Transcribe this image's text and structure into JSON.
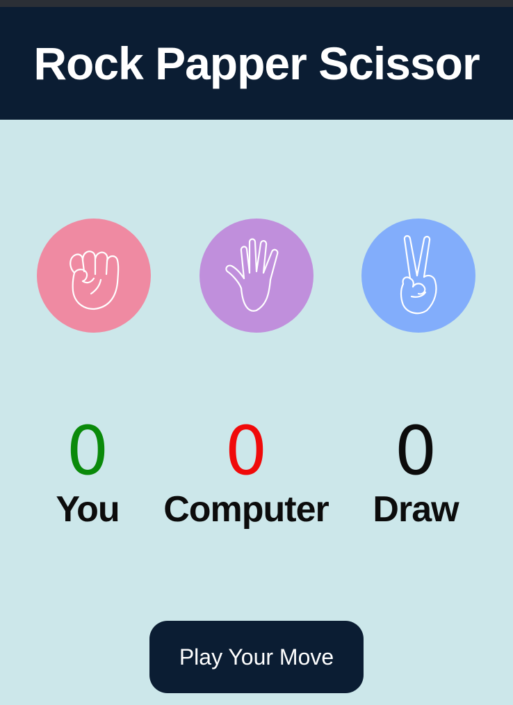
{
  "app": {
    "title": "Rock Papper Scissor"
  },
  "choices": [
    {
      "id": "rock",
      "icon": "fist-icon",
      "color": "#ef8aa2"
    },
    {
      "id": "paper",
      "icon": "open-hand-icon",
      "color": "#c08fdc"
    },
    {
      "id": "scissor",
      "icon": "victory-hand-icon",
      "color": "#82adfb"
    }
  ],
  "scores": {
    "you": {
      "value": "0",
      "label": "You",
      "color": "#0a8a0a"
    },
    "computer": {
      "value": "0",
      "label": "Computer",
      "color": "#f00a0a"
    },
    "draw": {
      "value": "0",
      "label": "Draw",
      "color": "#0c0c0c"
    }
  },
  "play_button": {
    "label": "Play Your Move"
  },
  "colors": {
    "header_bg": "#0b1d33",
    "page_bg": "#cce7ea"
  }
}
